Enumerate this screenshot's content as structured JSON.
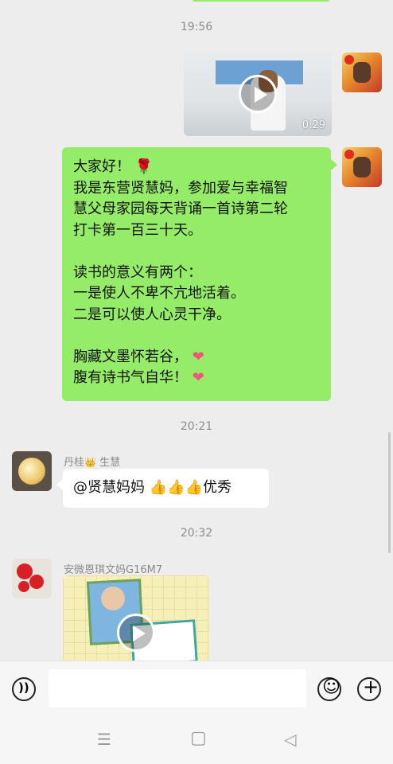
{
  "chat": {
    "timestamps": [
      "19:56",
      "20:21",
      "20:32"
    ],
    "video_message": {
      "duration": "0:29"
    },
    "self_text_message": {
      "lines": [
        "大家好！",
        "我是东营贤慧妈，参加爱与幸福智",
        "慧父母家园每天背诵一首诗第二轮",
        "打卡第一百三十天。",
        "",
        "读书的意义有两个：",
        "一是使人不卑不亢地活着。",
        "二是可以使人心灵干净。",
        "",
        "胸藏文墨怀若谷，",
        "腹有诗书气自华！"
      ],
      "emoji": {
        "rose": "🌹",
        "heart": "❤"
      }
    },
    "reply_message": {
      "sender_name": "丹桂",
      "sender_suffix": "生慧",
      "crown": "👑",
      "mention": "@贤慧妈妈",
      "thumbs": "👍👍👍",
      "tail_text": "优秀"
    },
    "last_message": {
      "sender_name": "安微恩琪文妈G16M7"
    }
  },
  "input_bar": {
    "voice_icon": "voice-icon",
    "emoji_icon": "emoji-icon",
    "plus_icon": "plus-icon",
    "emoji_glyph": "☺",
    "plus_glyph": "+",
    "voice_glyph": "))"
  },
  "nav": {
    "menu_glyph": "☰",
    "home_glyph": "▢",
    "back_glyph": "◁"
  },
  "colors": {
    "self_bubble": "#95ec69",
    "other_bubble": "#ffffff",
    "background": "#ededed"
  }
}
